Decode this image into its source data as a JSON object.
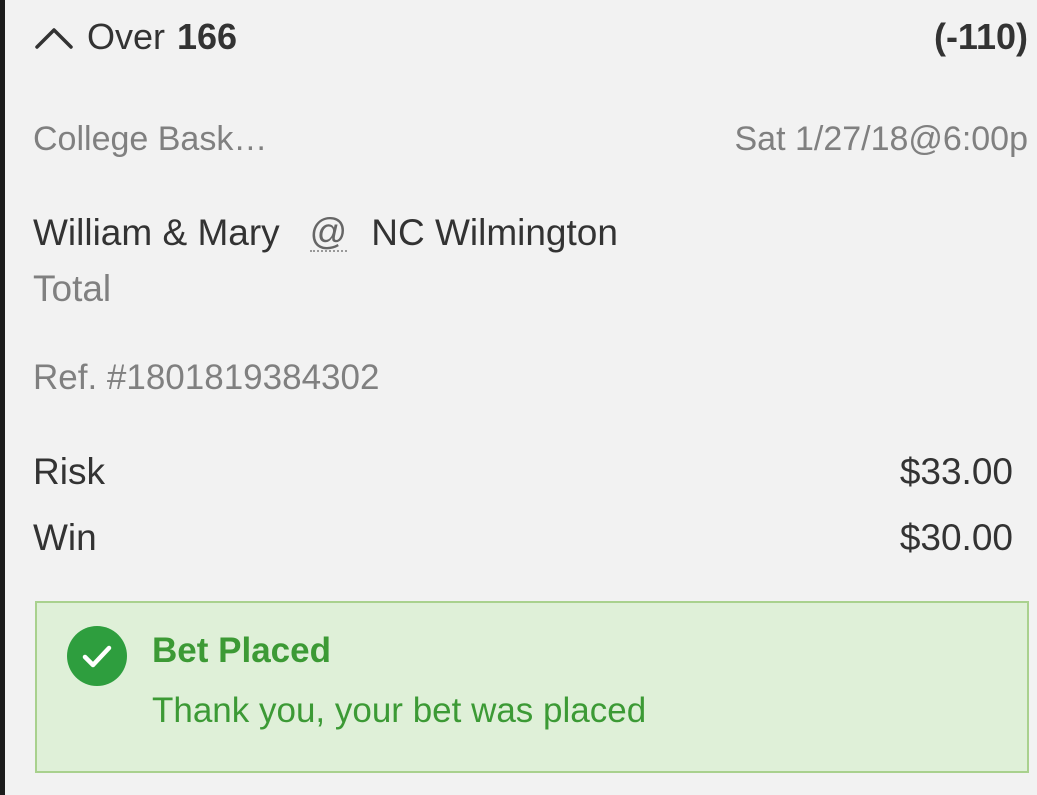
{
  "bet": {
    "selection_label": "Over",
    "selection_value": "166",
    "odds": "(-110)",
    "league": "College Bask…",
    "datetime": "Sat 1/27/18@6:00p",
    "away_team": "William & Mary",
    "at_symbol": "@",
    "home_team": "NC Wilmington",
    "market": "Total",
    "reference": "Ref. #1801819384302"
  },
  "amounts": {
    "risk_label": "Risk",
    "risk_value": "$33.00",
    "win_label": "Win",
    "win_value": "$30.00"
  },
  "confirmation": {
    "title": "Bet Placed",
    "message": "Thank you, your bet was placed",
    "icon": "check-circle-icon",
    "color": "#3c9a35",
    "background": "#dff0d8"
  },
  "icons": {
    "collapse": "chevron-up-icon"
  }
}
